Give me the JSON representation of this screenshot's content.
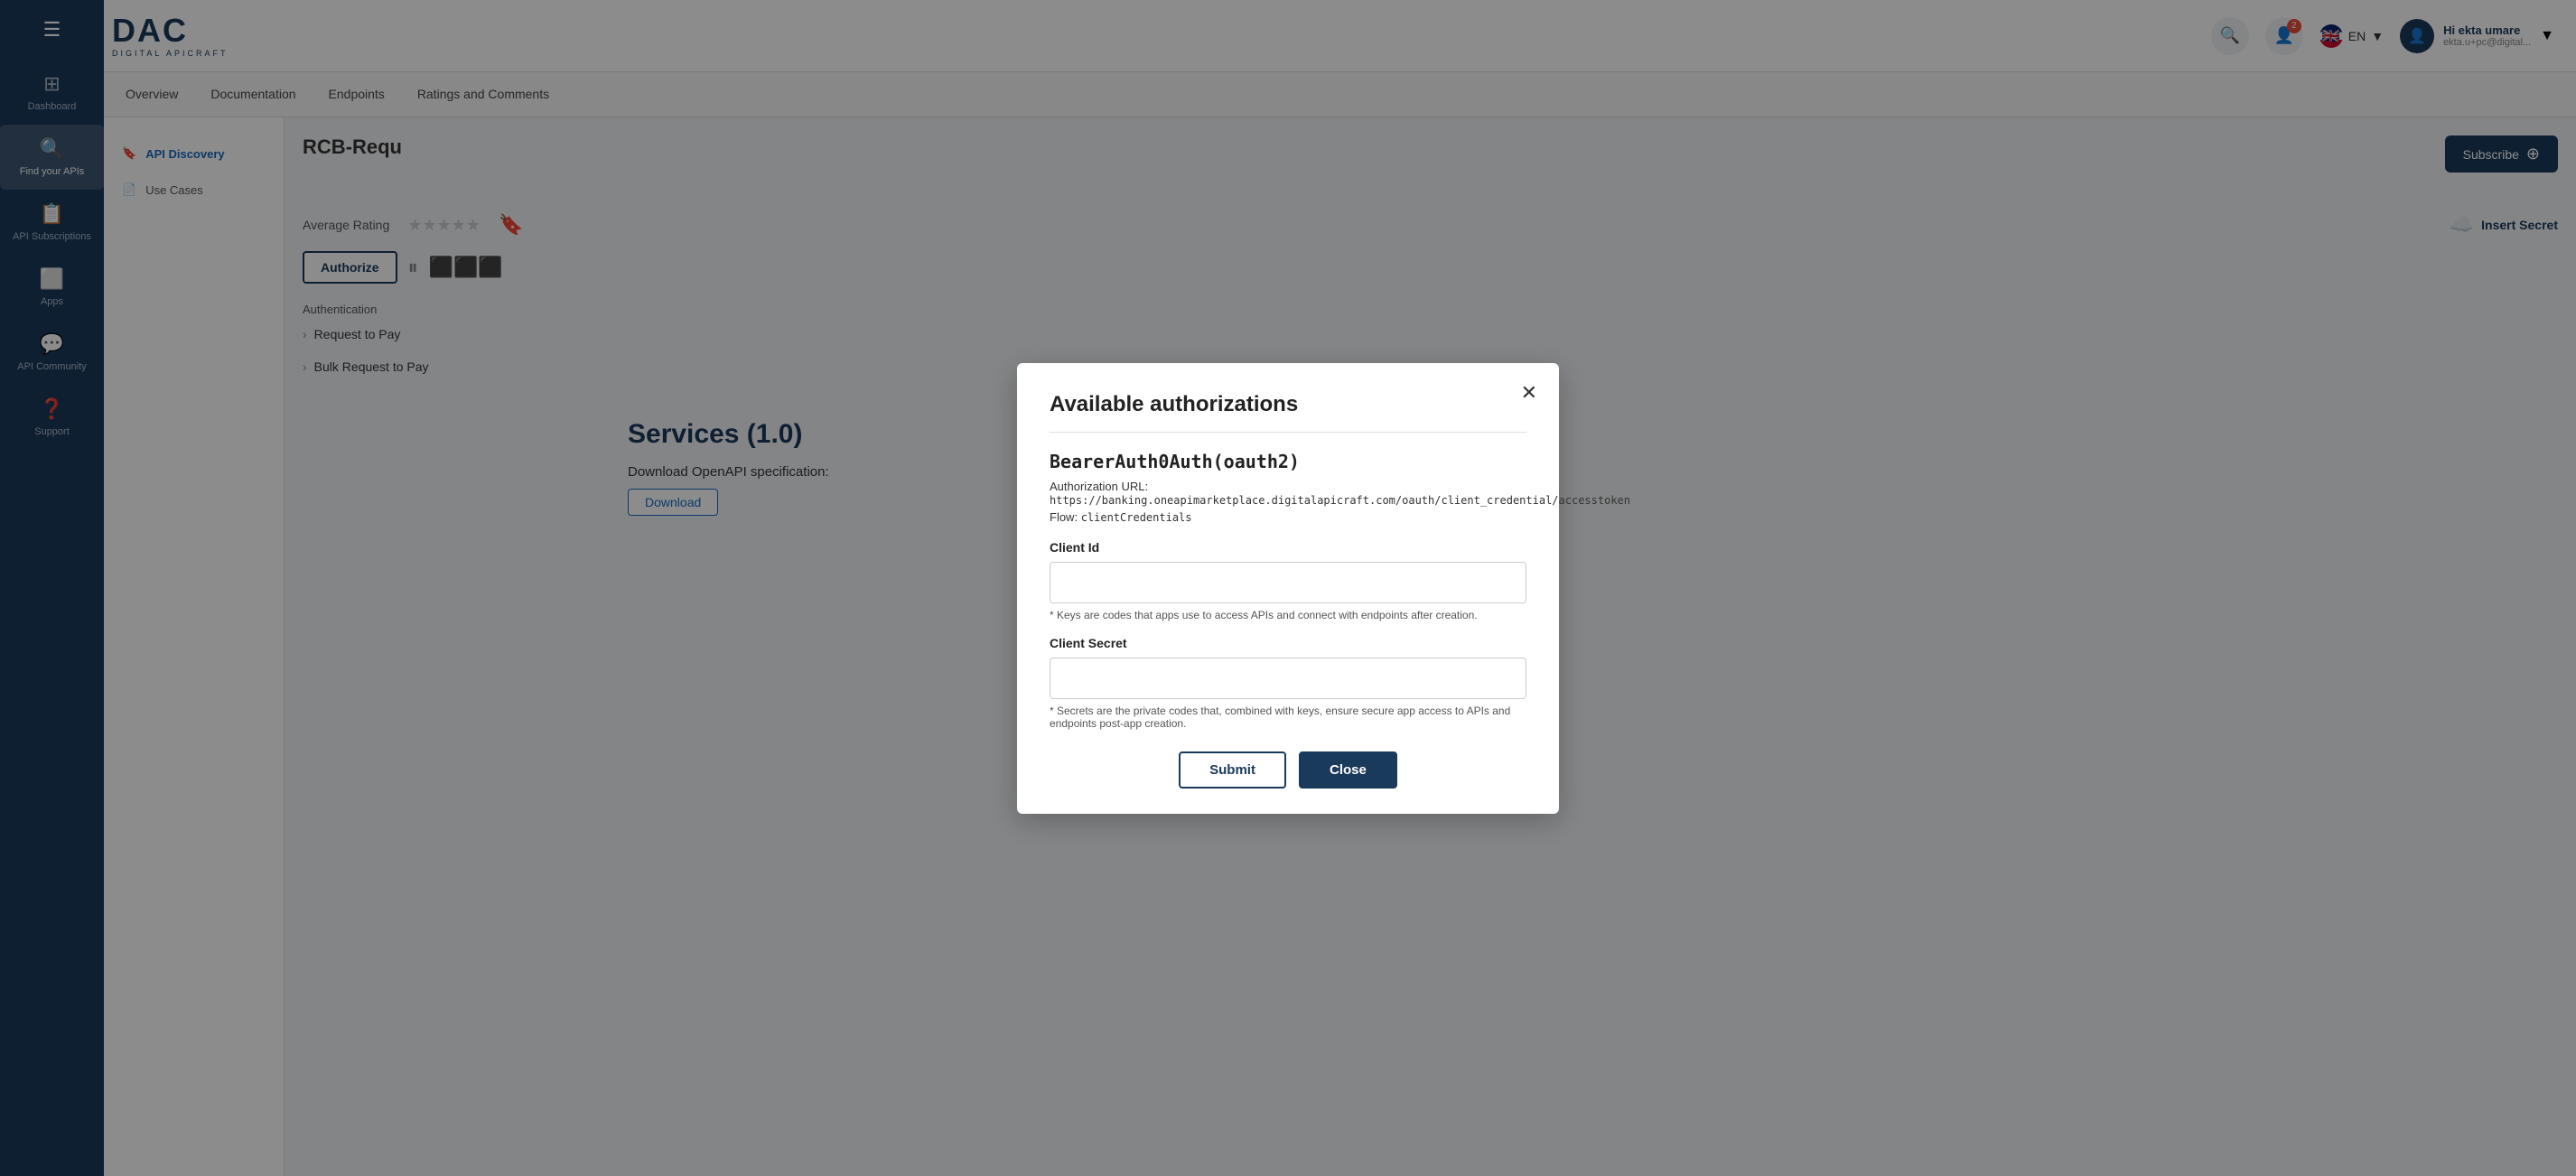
{
  "app": {
    "logo_main": "DAC",
    "logo_sub": "DIGITAL APICRAFT"
  },
  "navbar": {
    "search_icon": "🔍",
    "notification_icon": "👤",
    "notification_count": "2",
    "language": "EN",
    "user_greeting": "Hi ekta umare",
    "user_email": "ekta.u+pc@digital...",
    "chevron_icon": "▼"
  },
  "sidebar": {
    "menu_icon": "☰",
    "items": [
      {
        "id": "dashboard",
        "label": "Dashboard",
        "icon": "⊞"
      },
      {
        "id": "find-your-apis",
        "label": "Find your APIs",
        "icon": "🔍",
        "active": true
      },
      {
        "id": "api-subscriptions",
        "label": "API Subscriptions",
        "icon": "📋"
      },
      {
        "id": "apps",
        "label": "Apps",
        "icon": "⬜"
      },
      {
        "id": "api-community",
        "label": "API Community",
        "icon": "💬"
      },
      {
        "id": "support",
        "label": "Support",
        "icon": "❓"
      }
    ]
  },
  "subnav": {
    "items": [
      {
        "id": "overview",
        "label": "Overview"
      },
      {
        "id": "documentation",
        "label": "Documentation"
      },
      {
        "id": "endpoints",
        "label": "Endpoints"
      },
      {
        "id": "ratings",
        "label": "Ratings and Comments"
      }
    ]
  },
  "left_panel": {
    "items": [
      {
        "id": "api-discovery",
        "label": "API Discovery",
        "active": true
      },
      {
        "id": "use-cases",
        "label": "Use Cases",
        "active": false
      }
    ]
  },
  "main": {
    "page_title": "RCB-Requ",
    "subscribe_btn": "Subscribe",
    "average_rating_label": "Average Rating",
    "insert_secret_label": "Insert Secret",
    "authorize_btn": "Authorize",
    "services_title": "Services (1.0)",
    "download_spec_label": "Download OpenAPI specification:",
    "download_btn": "Download",
    "authentication_label": "Authentication",
    "accordion_items": [
      {
        "label": "Request to Pay"
      },
      {
        "label": "Bulk Request to Pay"
      }
    ]
  },
  "dialog": {
    "title": "Available authorizations",
    "close_icon": "✕",
    "auth_name": "BearerAuth0Auth(oauth2)",
    "auth_url_label": "Authorization URL:",
    "auth_url_value": "https://banking.oneapimarketplace.digitalapicraft.com/oauth/client_credential/accesstoken",
    "flow_label": "Flow:",
    "flow_value": "clientCredentials",
    "client_id_label": "Client Id",
    "client_id_placeholder": "",
    "client_id_hint": "* Keys are codes that apps use to access APIs and connect with endpoints after creation.",
    "client_secret_label": "Client Secret",
    "client_secret_placeholder": "",
    "client_secret_hint": "* Secrets are the private codes that, combined with keys, ensure secure app access to APIs and endpoints post-app creation.",
    "submit_btn": "Submit",
    "close_btn": "Close"
  }
}
